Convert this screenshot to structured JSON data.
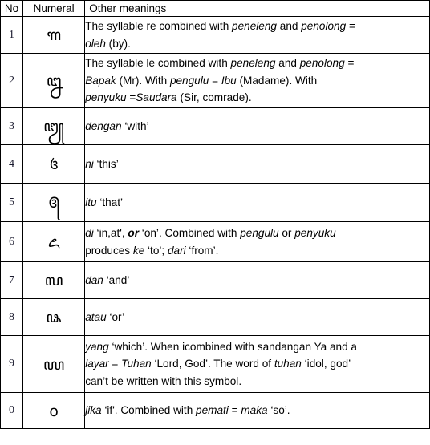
{
  "table": {
    "headers": {
      "no": "No",
      "numeral": "Numeral",
      "meanings": "Other meanings"
    },
    "rows": [
      {
        "no": "1",
        "numeral_glyph": "꧑",
        "numeral_alt": "ꦩꦸ",
        "lines": [
          "The syllable re combined with <i>peneleng</i> and <i>penolong</i> =",
          "<i>oleh</i> (by)."
        ],
        "plain_text": "The syllable re combined with peneleng and penolong = oleh (by)."
      },
      {
        "no": "2",
        "numeral_glyph": "꧒",
        "numeral_alt": "ꦑ",
        "lines": [
          "The syllable le combined with <i>peneleng</i> and <i>penolong</i>  =",
          "<i>Bapak</i> (Mr). With <i>pengulu</i> = <i>Ibu</i> (Madame). With",
          "<i>penyuku</i> =<i>Saudara</i> (Sir, comrade)."
        ],
        "plain_text": "The syllable le combined with peneleng and penolong = Bapak (Mr). With pengulu = Ibu (Madame). With penyuku =Saudara (Sir, comrade)."
      },
      {
        "no": "3",
        "numeral_glyph": "꧓",
        "numeral_alt": "ꦔꦸ",
        "lines": [
          "<i>dengan</i> ‘with’"
        ],
        "plain_text": "dengan ‘with’"
      },
      {
        "no": "4",
        "numeral_glyph": "꧔",
        "numeral_alt": "ꦕ",
        "lines": [
          "<i>ni</i> ‘this’"
        ],
        "plain_text": "ni ‘this’"
      },
      {
        "no": "5",
        "numeral_glyph": "꧕",
        "numeral_alt": "ꦖ",
        "lines": [
          "<i>itu</i> ‘that’"
        ],
        "plain_text": "itu ‘that’"
      },
      {
        "no": "6",
        "numeral_glyph": "꧖",
        "numeral_alt": "ꦗ",
        "lines": [
          "<i>di</i> ‘in,at', <b class=\"bi\">or</b>  ‘on’. Combined with <i>pengulu</i> or <i>penyuku</i>",
          "produces <i>ke</i> ‘to’; <i>dari</i> ‘from’."
        ],
        "plain_text": "di ‘in,at', or ‘on’. Combined with pengulu or penyuku produces ke ‘to’; dari ‘from’."
      },
      {
        "no": "7",
        "numeral_glyph": "꧗",
        "numeral_alt": "ꦚ",
        "lines": [
          "<i>dan</i> ‘and’"
        ],
        "plain_text": "dan ‘and’"
      },
      {
        "no": "8",
        "numeral_glyph": "꧘",
        "numeral_alt": "ꦛ",
        "lines": [
          "<i>atau</i> ‘or’"
        ],
        "plain_text": "atau ‘or’"
      },
      {
        "no": "9",
        "numeral_glyph": "꧙",
        "numeral_alt": "ꦜ",
        "lines": [
          "<i>yang</i> ‘which’. When icombined with sandangan Ya and a",
          "<i>layar</i> = <i>Tuhan</i> ‘Lord, God’. The word of <i>tuhan</i> ‘idol, god’",
          "can’t be written with this symbol."
        ],
        "plain_text": "yang ‘which’. When icombined with sandangan Ya and a layar = Tuhan ‘Lord, God’. The word of tuhan ‘idol, god’ can’t be written with this symbol."
      },
      {
        "no": "0",
        "numeral_glyph": "꧐",
        "numeral_alt": "○",
        "lines": [
          "<i>jika</i> ‘if'. Combined with <i>pemati</i> = <i>maka</i> ‘so’."
        ],
        "plain_text": "jika ‘if'. Combined with pemati = maka ‘so’."
      }
    ]
  },
  "colors": {
    "border": "#000000",
    "text": "#000000",
    "background": "#ffffff"
  }
}
